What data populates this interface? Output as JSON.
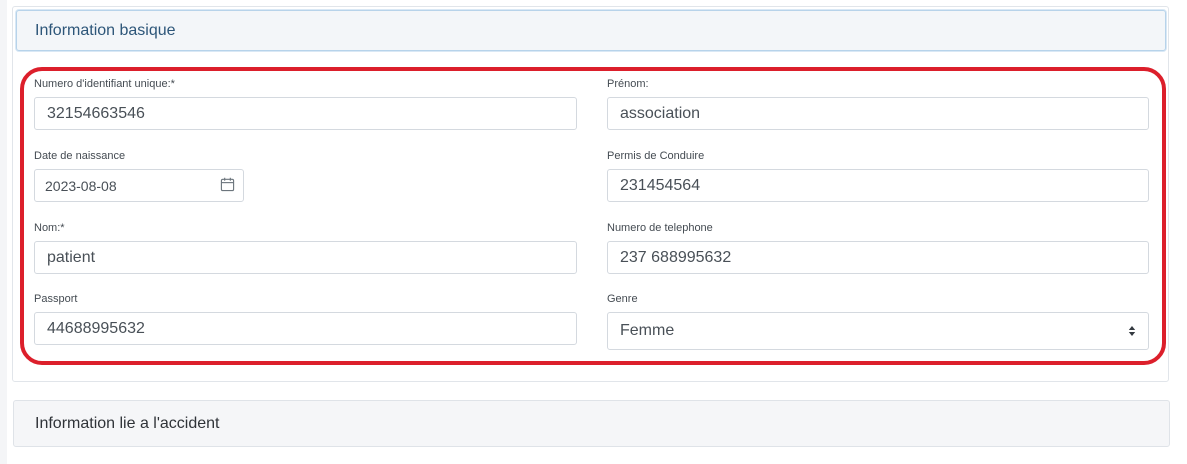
{
  "section_basic": {
    "title": "Information basique"
  },
  "form": {
    "unique_id": {
      "label": "Numero d'identifiant unique:*",
      "value": "32154663546"
    },
    "first_name": {
      "label": "Prénom:",
      "value": "association"
    },
    "birth_date": {
      "label": "Date de naissance",
      "value": "2023-08-08"
    },
    "driving_license": {
      "label": "Permis de Conduire",
      "value": "231454564"
    },
    "last_name": {
      "label": "Nom:*",
      "value": "patient"
    },
    "phone": {
      "label": "Numero de telephone",
      "value": "237 688995632"
    },
    "passport": {
      "label": "Passport",
      "value": "44688995632"
    },
    "gender": {
      "label": "Genre",
      "selected": "Femme"
    }
  },
  "section_accident": {
    "title": "Information lie a l'accident"
  },
  "colors": {
    "highlight": "#dc1f2b",
    "header_text": "#2d5679"
  }
}
